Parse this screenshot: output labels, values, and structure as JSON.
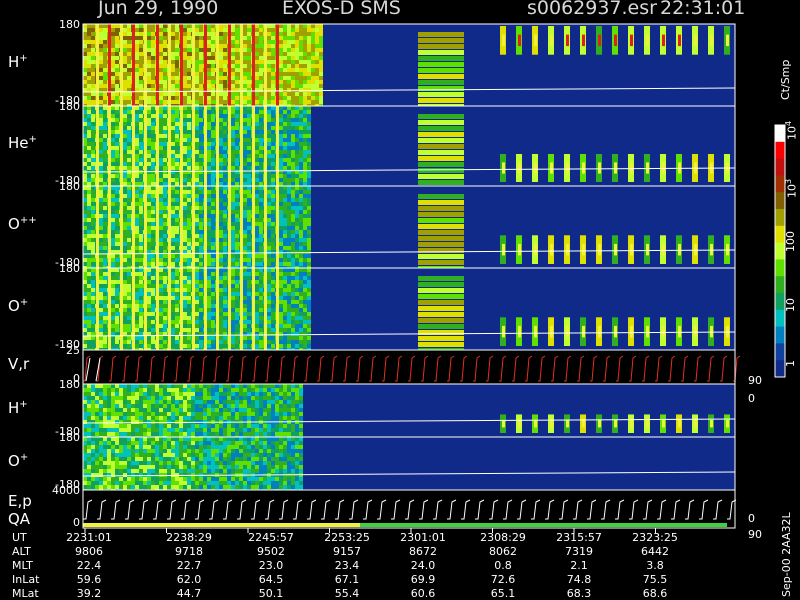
{
  "header": {
    "date": "Jun 29, 1990",
    "mission": "EXOS-D SMS",
    "file": "s0062937.esr",
    "time": "22:31:01"
  },
  "colors": {
    "background": "#000000",
    "spectrogram_base": "#102a8a",
    "trace": "#ffffff",
    "velocity_trace": "#e03020",
    "status_bar": "#f0f040"
  },
  "panels": [
    {
      "name": "H+",
      "label": "H",
      "sup": "+",
      "top_tick": "180",
      "bottom_tick": "-180"
    },
    {
      "name": "He+",
      "label": "He",
      "sup": "+",
      "top_tick": "180",
      "bottom_tick": "-180"
    },
    {
      "name": "O++",
      "label": "O",
      "sup": "++",
      "top_tick": "180",
      "bottom_tick": "-180"
    },
    {
      "name": "O+",
      "label": "O",
      "sup": "+",
      "top_tick": "180",
      "bottom_tick": "-180"
    },
    {
      "name": "V,r",
      "label": "V,r",
      "sup": "",
      "top_tick": "25",
      "bottom_tick": "0",
      "right_top": "90",
      "right_bottom": "0"
    },
    {
      "name": "H+ low",
      "label": "H",
      "sup": "+",
      "top_tick": "180",
      "bottom_tick": "-180"
    },
    {
      "name": "O+ low",
      "label": "O",
      "sup": "+",
      "top_tick": "180",
      "bottom_tick": "-180",
      "right_bottom": "90"
    },
    {
      "name": "E,p QA",
      "label": "E,p",
      "label2": "QA",
      "top_tick": "4000",
      "bottom_tick": "0",
      "right_bottom": "0"
    }
  ],
  "colorbar": {
    "unit": "Ct/Smp",
    "ticks": [
      "10",
      "10",
      "100",
      "10",
      "1"
    ],
    "tick_exponents": [
      "4",
      "3",
      "",
      "",
      ""
    ],
    "colors": [
      "#ffffff",
      "#ff0000",
      "#c01010",
      "#a03000",
      "#806000",
      "#a0a000",
      "#e0e000",
      "#c0ff30",
      "#60e000",
      "#30b020",
      "#10a060",
      "#00c0c0",
      "#0080c0",
      "#1040a0",
      "#102a8a"
    ]
  },
  "chart_data": {
    "type": "heatmap",
    "title": "Jun 29, 1990   EXOS-D SMS",
    "x_ticks_ut": [
      "2231:01",
      "2238:29",
      "2245:57",
      "2253:25",
      "2301:01",
      "2308:29",
      "2315:57",
      "2323:25"
    ],
    "ephemeris": [
      {
        "name": "UT",
        "values": [
          "2231:01",
          "2238:29",
          "2245:57",
          "2253:25",
          "2301:01",
          "2308:29",
          "2315:57",
          "2323:25"
        ]
      },
      {
        "name": "ALT",
        "values": [
          "9806",
          "9718",
          "9502",
          "9157",
          "8672",
          "8062",
          "7319",
          "6442"
        ]
      },
      {
        "name": "MLT",
        "values": [
          "22.4",
          "22.7",
          "23.0",
          "23.4",
          "24.0",
          "0.8",
          "2.1",
          "3.8"
        ]
      },
      {
        "name": "InLat",
        "values": [
          "59.6",
          "62.0",
          "64.5",
          "67.1",
          "69.9",
          "72.6",
          "74.8",
          "75.5"
        ]
      },
      {
        "name": "MLat",
        "values": [
          "39.2",
          "44.7",
          "50.1",
          "55.4",
          "60.6",
          "65.1",
          "68.3",
          "68.6"
        ]
      }
    ],
    "y_range_angle": [
      -180,
      180
    ],
    "y_range_velocity": [
      0,
      25
    ],
    "y_range_energy": [
      0,
      4000
    ],
    "colorbar_range": [
      1,
      10000
    ],
    "colorbar_scale": "log"
  },
  "footer": {
    "file_tag": "Sep-00  2AA32L"
  }
}
